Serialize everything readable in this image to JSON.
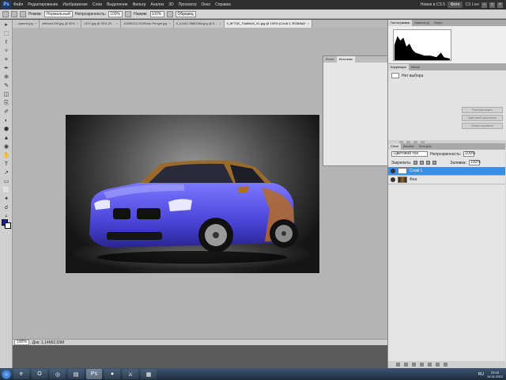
{
  "menubar": {
    "logo": "Ps",
    "items": [
      "Файл",
      "Редактирование",
      "Изображение",
      "Слои",
      "Выделение",
      "Фильтр",
      "Анализ",
      "3D",
      "Просмотр",
      "Окно",
      "Справка"
    ],
    "workspace_label": "Новое в CS 5",
    "workspace_btn": "Фото",
    "cs_live": "CS Live",
    "ctl_min": "–",
    "ctl_max": "□",
    "ctl_close": "×"
  },
  "optbar": {
    "mode_label": "Режим:",
    "mode_value": "Нормальный",
    "opacity_label": "Непрозрачность:",
    "opacity_value": "100%",
    "flow_label": "Нажим:",
    "flow_value": "100%",
    "sample_btn": "Образец"
  },
  "tabs": [
    {
      "label": "…зумент.jpg",
      "active": false
    },
    {
      "label": "offshore100.jpg @ 50%",
      "active": false
    },
    {
      "label": "1197.jpg @ 50% (R…",
      "active": false
    },
    {
      "label": "10098112-004Rose-Pengal.jpg",
      "active": false
    },
    {
      "label": "0_b1601-9f8815ba.jpg @ 6…",
      "active": false
    },
    {
      "label": "0_6F71R_73ufb5c5_XL.jpg @ 100% (Слой 1, RGB/8#)*",
      "active": true
    }
  ],
  "tools": [
    "▸",
    "⬚",
    "ℓ",
    "✧",
    "⌗",
    "✒",
    "⊕",
    "✎",
    "◫",
    "⎘",
    "✐",
    "◐",
    "⬢",
    "▲",
    "◉",
    "✋",
    "T",
    "↗",
    "▭",
    "⬜",
    "✦",
    "☌",
    "⌕",
    "▣"
  ],
  "float_panel": {
    "tabs": [
      "Кисти",
      "Источник"
    ]
  },
  "statusbar": {
    "zoom": "100%",
    "doc": "Док: 1,14M/2,03M"
  },
  "dock": {
    "top_tabs": [
      "Гистограмма",
      "Навигатор",
      "Инфо"
    ],
    "adjust_tabs": [
      "Коррекция",
      "Маски"
    ],
    "adjust_label": "Нет выбора",
    "adjust_buttons": [
      "Растрировать",
      "Цветовой диапазон",
      "Инвертировать"
    ],
    "layers_tabs": [
      "Слои",
      "Каналы",
      "Контуры"
    ],
    "blend_mode": "Цветовой тон",
    "opacity_label": "Непрозрачность:",
    "opacity_value": "100%",
    "lock_label": "Закрепить:",
    "fill_label": "Заливка:",
    "fill_value": "100%",
    "layers": [
      {
        "name": "Слой 1",
        "selected": true,
        "thumb": "clouds"
      },
      {
        "name": "Фон",
        "selected": false,
        "thumb": "bg"
      }
    ]
  },
  "taskbar": {
    "apps": [
      {
        "name": "ie",
        "glyph": "e"
      },
      {
        "name": "opera",
        "glyph": "O"
      },
      {
        "name": "chrome",
        "glyph": "◎"
      },
      {
        "name": "folder",
        "glyph": "▤"
      },
      {
        "name": "photoshop",
        "glyph": "Ps"
      },
      {
        "name": "firefox",
        "glyph": "●"
      },
      {
        "name": "game",
        "glyph": "⚔"
      },
      {
        "name": "calc",
        "glyph": "▦"
      }
    ],
    "lang": "RU",
    "time": "23:18",
    "date": "14.01.2012"
  },
  "colors": {
    "foreground": "#1a1ab0",
    "background": "#ffffff",
    "selection": "#3a8ee6"
  }
}
